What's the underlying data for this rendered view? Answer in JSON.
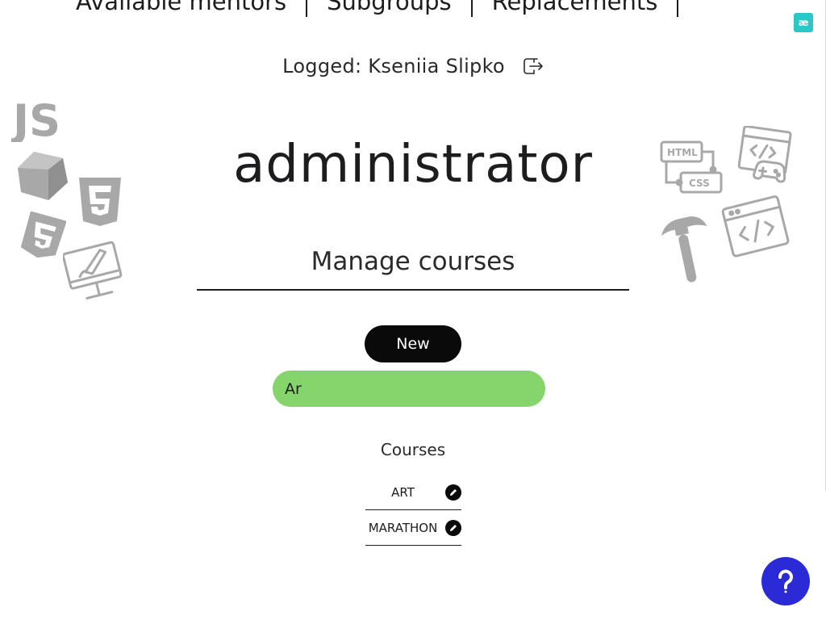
{
  "nav": {
    "items": [
      "Available mentors",
      "Subgroups",
      "Replacements"
    ]
  },
  "lang_badge": "æ",
  "header": {
    "logged_text": "Logged: Kseniia Slipko"
  },
  "role": "administrator",
  "section_title": "Manage courses",
  "new_button": "New",
  "search": {
    "value": "Ar",
    "placeholder": ""
  },
  "courses": {
    "label": "Courses",
    "items": [
      {
        "name": "ART"
      },
      {
        "name": "MARATHON"
      }
    ]
  },
  "decorations": {
    "left": [
      "js-logo-icon",
      "cube-icon",
      "html5-icon",
      "css3-icon",
      "designer-monitor-icon"
    ],
    "right": [
      "html-css-icon",
      "code-gamepad-icon",
      "hammer-icon",
      "code-window-icon"
    ]
  },
  "colors": {
    "accent_green": "#86d46c",
    "help_blue": "#2a2ad6",
    "badge_teal": "#2cc8c8",
    "deco_gray": "#a8a8a8"
  }
}
